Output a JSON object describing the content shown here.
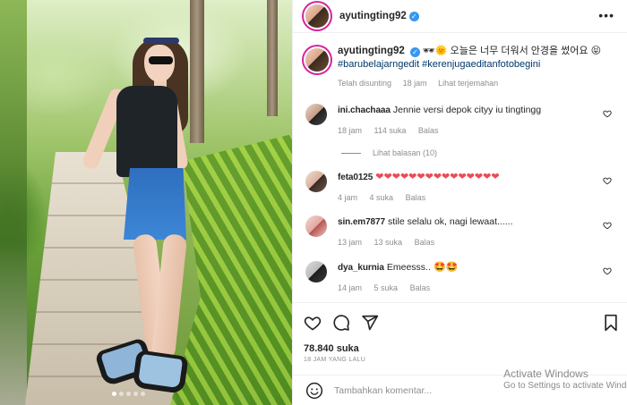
{
  "post": {
    "username": "ayutingting92",
    "verified_mark": "✓",
    "more_label": "•••",
    "caption_emojis": "🕶🌞",
    "caption_text": "오늘은 너무 더워서 안경을 썼어요",
    "caption_end_emoji": "😝",
    "hashtags": "#barubelajarngedit #kerenjugaeditanfotobegini",
    "edited_label": "Telah disunting",
    "age": "18 jam",
    "translate_label": "Lihat terjemahan",
    "likes": "78.840 suka",
    "date": "18 JAM YANG LALU",
    "carousel_dots": 5,
    "carousel_active": 0
  },
  "comments": [
    {
      "user": "ini.chachaaa",
      "text": "Jennie versi depok cityy iu tingtingg",
      "time": "18 jam",
      "likes": "114 suka",
      "reply": "Balas",
      "replies": "Lihat balasan (10)"
    },
    {
      "user": "feta0125",
      "text": "❤❤❤❤❤❤❤❤❤❤❤❤❤❤❤",
      "time": "4 jam",
      "likes": "4 suka",
      "reply": "Balas"
    },
    {
      "user": "sin.em7877",
      "text": "stile selalu ok, nagi lewaat......",
      "time": "13 jam",
      "likes": "13 suka",
      "reply": "Balas"
    },
    {
      "user": "dya_kurnia",
      "text": "Emeesss..",
      "emoji": "🤩🤩",
      "time": "14 jam",
      "likes": "5 suka",
      "reply": "Balas"
    }
  ],
  "composer": {
    "placeholder": "Tambahkan komentar..."
  },
  "icons": {
    "like": "heart-icon",
    "comment": "comment-icon",
    "share": "share-icon",
    "save": "bookmark-icon",
    "emoji": "emoji-icon"
  },
  "overlay": {
    "activate_title": "Activate Windows",
    "activate_sub": "Go to Settings to activate Windows."
  },
  "colors": {
    "link": "#00376b",
    "heart": "#ed4956",
    "muted": "#8e8e8e",
    "verified": "#3897f0"
  }
}
